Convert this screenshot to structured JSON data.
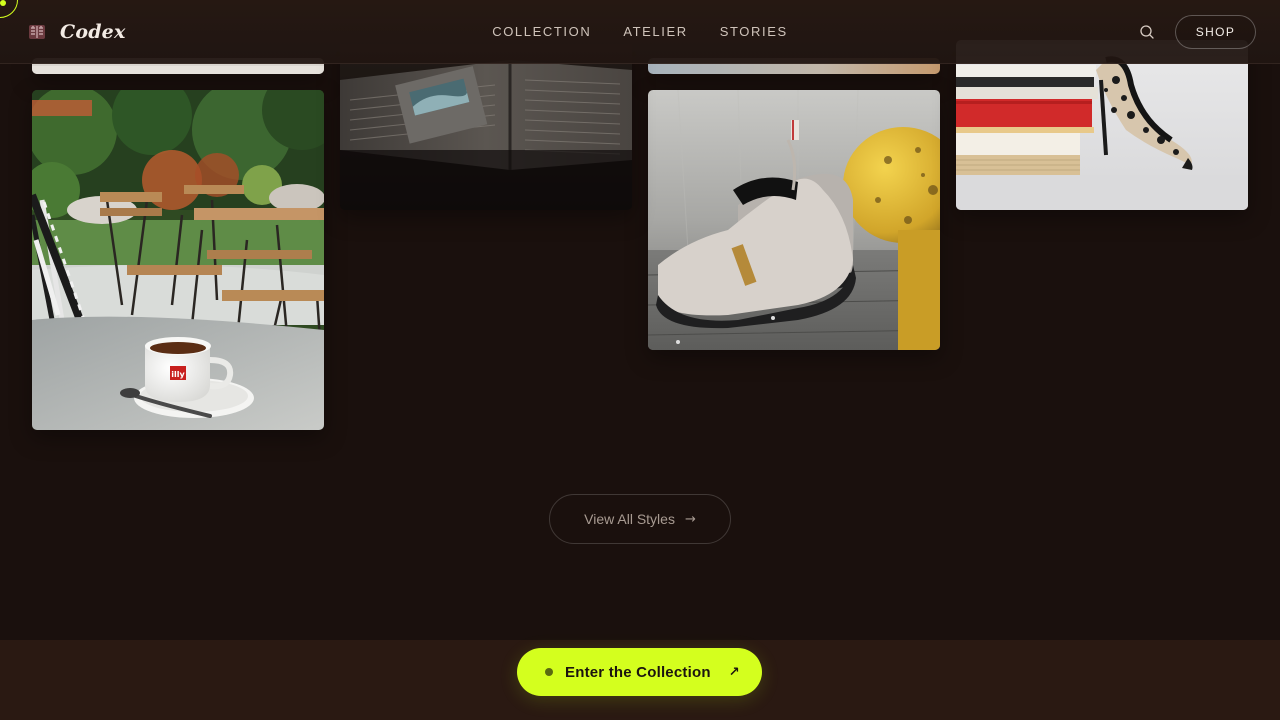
{
  "brand": {
    "name": "Codex",
    "icon": "book-logo-icon"
  },
  "nav": {
    "items": [
      "COLLECTION",
      "ATELIER",
      "STORIES"
    ]
  },
  "header_actions": {
    "search_icon": "search-icon",
    "shop_label": "SHOP"
  },
  "gallery": {
    "items": [
      {
        "subject": "cafe-espresso",
        "alt": ""
      },
      {
        "subject": "open-book",
        "alt": ""
      },
      {
        "subject": "suede-slip-on-shoes",
        "alt": ""
      },
      {
        "subject": "heels-on-books",
        "alt": ""
      }
    ]
  },
  "view_all": {
    "label": "View All Styles",
    "arrow": "→"
  },
  "cta": {
    "label": "Enter the Collection",
    "arrow": "↗"
  },
  "colors": {
    "background": "#1a100d",
    "header": "#261813",
    "accent": "#d4ff1e",
    "footer_band": "#2a1912"
  }
}
